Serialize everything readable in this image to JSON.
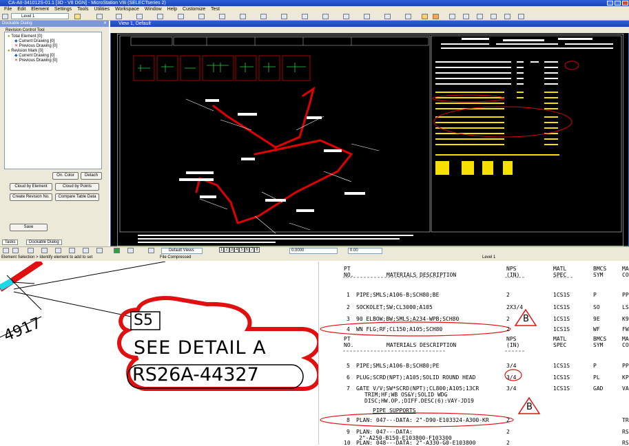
{
  "app": {
    "title": "CA-AII-341012S-01.1 [3D - V8 DGN] - MicroStation V8i (SELECTseries 2)",
    "menu": [
      "File",
      "Edit",
      "Element",
      "Settings",
      "Tools",
      "Utilities",
      "Workspace",
      "Window",
      "Help",
      "Customize",
      "Test"
    ],
    "level": "Level 1",
    "view_title": "View 1, Default",
    "view_dropdown": "Default Views",
    "views": [
      "1",
      "2",
      "3",
      "4",
      "5",
      "6",
      "7",
      "8"
    ],
    "zoom_a": "0.0000",
    "zoom_b": "0.00",
    "status_left": "Element Selection > Identify element to add to set",
    "status_mid": "File Compressed",
    "status_level": "Level 1"
  },
  "dock": {
    "header": "Dockable Dialog",
    "group_label": "Revision Control Tool",
    "tree": [
      {
        "label": "Total Element [0]",
        "level": 0
      },
      {
        "label": "Current Drawing [0]",
        "level": 1
      },
      {
        "label": "Previous Drawing [0]",
        "level": 1
      },
      {
        "label": "Revision Mark [0]",
        "level": 0
      },
      {
        "label": "Current Drawing [0]",
        "level": 1
      },
      {
        "label": "Previous Drawing [0]",
        "level": 1
      }
    ],
    "btn_on_color": "On. Color",
    "btn_detach": "Detach",
    "btn_cloud_element": "Cloud by Element",
    "btn_cloud_points": "Cloud by Points",
    "btn_create_rev": "Create Revision No.",
    "btn_compare": "Compare Table Data",
    "btn_save": "Save",
    "tab_tasks": "Tasks",
    "tab_dockable": "Dockable Dialog"
  },
  "detail": {
    "tag": "S5",
    "line1": "SEE DETAIL A",
    "line2": "RS26A-44327",
    "dim": "4917"
  },
  "bom": {
    "headers": {
      "pt_no": "PT\nNO.",
      "desc": "MATERIALS DESCRIPTION",
      "nps": "NPS\n(IN)",
      "matl": "MATL\nSPEC",
      "bmcs": "BMCS\nSYM",
      "ma": "MA\nCO"
    },
    "rows_a": [
      {
        "no": "1",
        "desc": "PIPE;SMLS;A106-B;SCH80;BE",
        "nps": "2",
        "matl": "1CS1S",
        "sym": "P",
        "co": "PP"
      },
      {
        "no": "2",
        "desc": "SOCKOLET;SW;CL3000;A105",
        "nps": "2X3/4",
        "matl": "1CS1S",
        "sym": "SO",
        "co": "LS"
      },
      {
        "no": "3",
        "desc": "90 ELBOW;BW;SMLS;A234-WPB;SCH80",
        "nps": "2",
        "matl": "1CS1S",
        "sym": "9E",
        "co": "K9"
      },
      {
        "no": "4",
        "desc": "WN FLG;RF;CL150;A105;SCH80",
        "nps": "2",
        "matl": "1CS1S",
        "sym": "WF",
        "co": "FW"
      }
    ],
    "rows_b": [
      {
        "no": "5",
        "desc": "PIPE;SMLS;A106-B;SCH80;PE",
        "nps": "3/4",
        "matl": "1CS1S",
        "sym": "P",
        "co": "PP"
      },
      {
        "no": "6",
        "desc": "PLUG;SCRD(NPT);A105;SOLID ROUND HEAD",
        "nps": "3/4",
        "matl": "1CS1S",
        "sym": "PL",
        "co": "KP"
      },
      {
        "no": "7",
        "desc": "GATE V/V;SW*SCRD(NPT);CL800;A105;13CR",
        "nps": "3/4",
        "matl": "1CS1S",
        "sym": "GAD",
        "co": "VA"
      }
    ],
    "row7_cont1": "TRIM;HF;WB OS&Y;SOLID WDG",
    "row7_cont2": "DISC;HW.OP.;DIFF.DESC(6):VAY-JD19",
    "pipe_supports": "PIPE SUPPORTS",
    "row8": {
      "no": "8",
      "desc": "PLAN: 047---DATA: 2\"-D90-E103324-A300-KR",
      "nps": "2",
      "co": "TR"
    },
    "row9": {
      "no": "9",
      "desc": "PLAN: 047---DATA:",
      "nps": "2",
      "co": "RS"
    },
    "row9_cont": "2\"-A250-B150-E103800-F103300",
    "row10": {
      "no": "10",
      "desc": "PLAN: 048---DATA: 2\"-A330-G0-E103800",
      "nps": "2",
      "co": "RS"
    },
    "rev_tag": "B"
  },
  "colors": {
    "accent_red": "#e00000",
    "cloud_red": "#e01010",
    "pipe_cyan": "#1ed8e8",
    "xp_blue": "#1d47b8"
  }
}
